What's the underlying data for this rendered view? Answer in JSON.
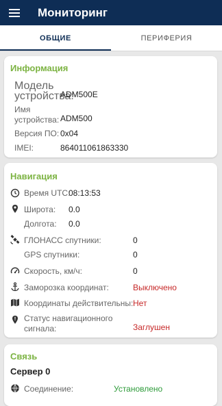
{
  "appbar": {
    "title": "Мониторинг"
  },
  "tabs": [
    {
      "label": "ОБЩИЕ",
      "active": true
    },
    {
      "label": "ПЕРИФЕРИЯ",
      "active": false
    }
  ],
  "info": {
    "title": "Информация",
    "model_label": "Модель устройства:",
    "model_value": "ADM500E",
    "name_label": "Имя устройства:",
    "name_value": "ADM500",
    "fw_label": "Версия ПО:",
    "fw_value": "0x04",
    "imei_label": "IMEI:",
    "imei_value": "864011061863330"
  },
  "nav": {
    "title": "Навигация",
    "utc_label": "Время UTC:",
    "utc_value": "08:13:53",
    "lat_label": "Широта:",
    "lat_value": "0.0",
    "lon_label": "Долгота:",
    "lon_value": "0.0",
    "glonass_label": "ГЛОНАСС спутники:",
    "glonass_value": "0",
    "gps_label": "GPS спутники:",
    "gps_value": "0",
    "speed_label": "Скорость, км/ч:",
    "speed_value": "0",
    "freeze_label": "Заморозка координат:",
    "freeze_value": "Выключено",
    "valid_label": "Координаты действительны:",
    "valid_value": "Нет",
    "status_label": "Статус навигационного сигнала:",
    "status_value": "Заглушен"
  },
  "comm": {
    "title": "Связь",
    "server_label": "Сервер 0",
    "conn_label": "Соединение:",
    "conn_value": "Установлено"
  },
  "colors": {
    "appbar": "#0e2d55",
    "section_title": "#7cb342",
    "alert": "#c62828",
    "ok": "#2e9b3a"
  },
  "icons": [
    "menu-icon",
    "clock-icon",
    "location-pin-icon",
    "satellite-icon",
    "speedometer-icon",
    "anchor-icon",
    "map-icon",
    "alert-pin-icon",
    "globe-icon"
  ]
}
